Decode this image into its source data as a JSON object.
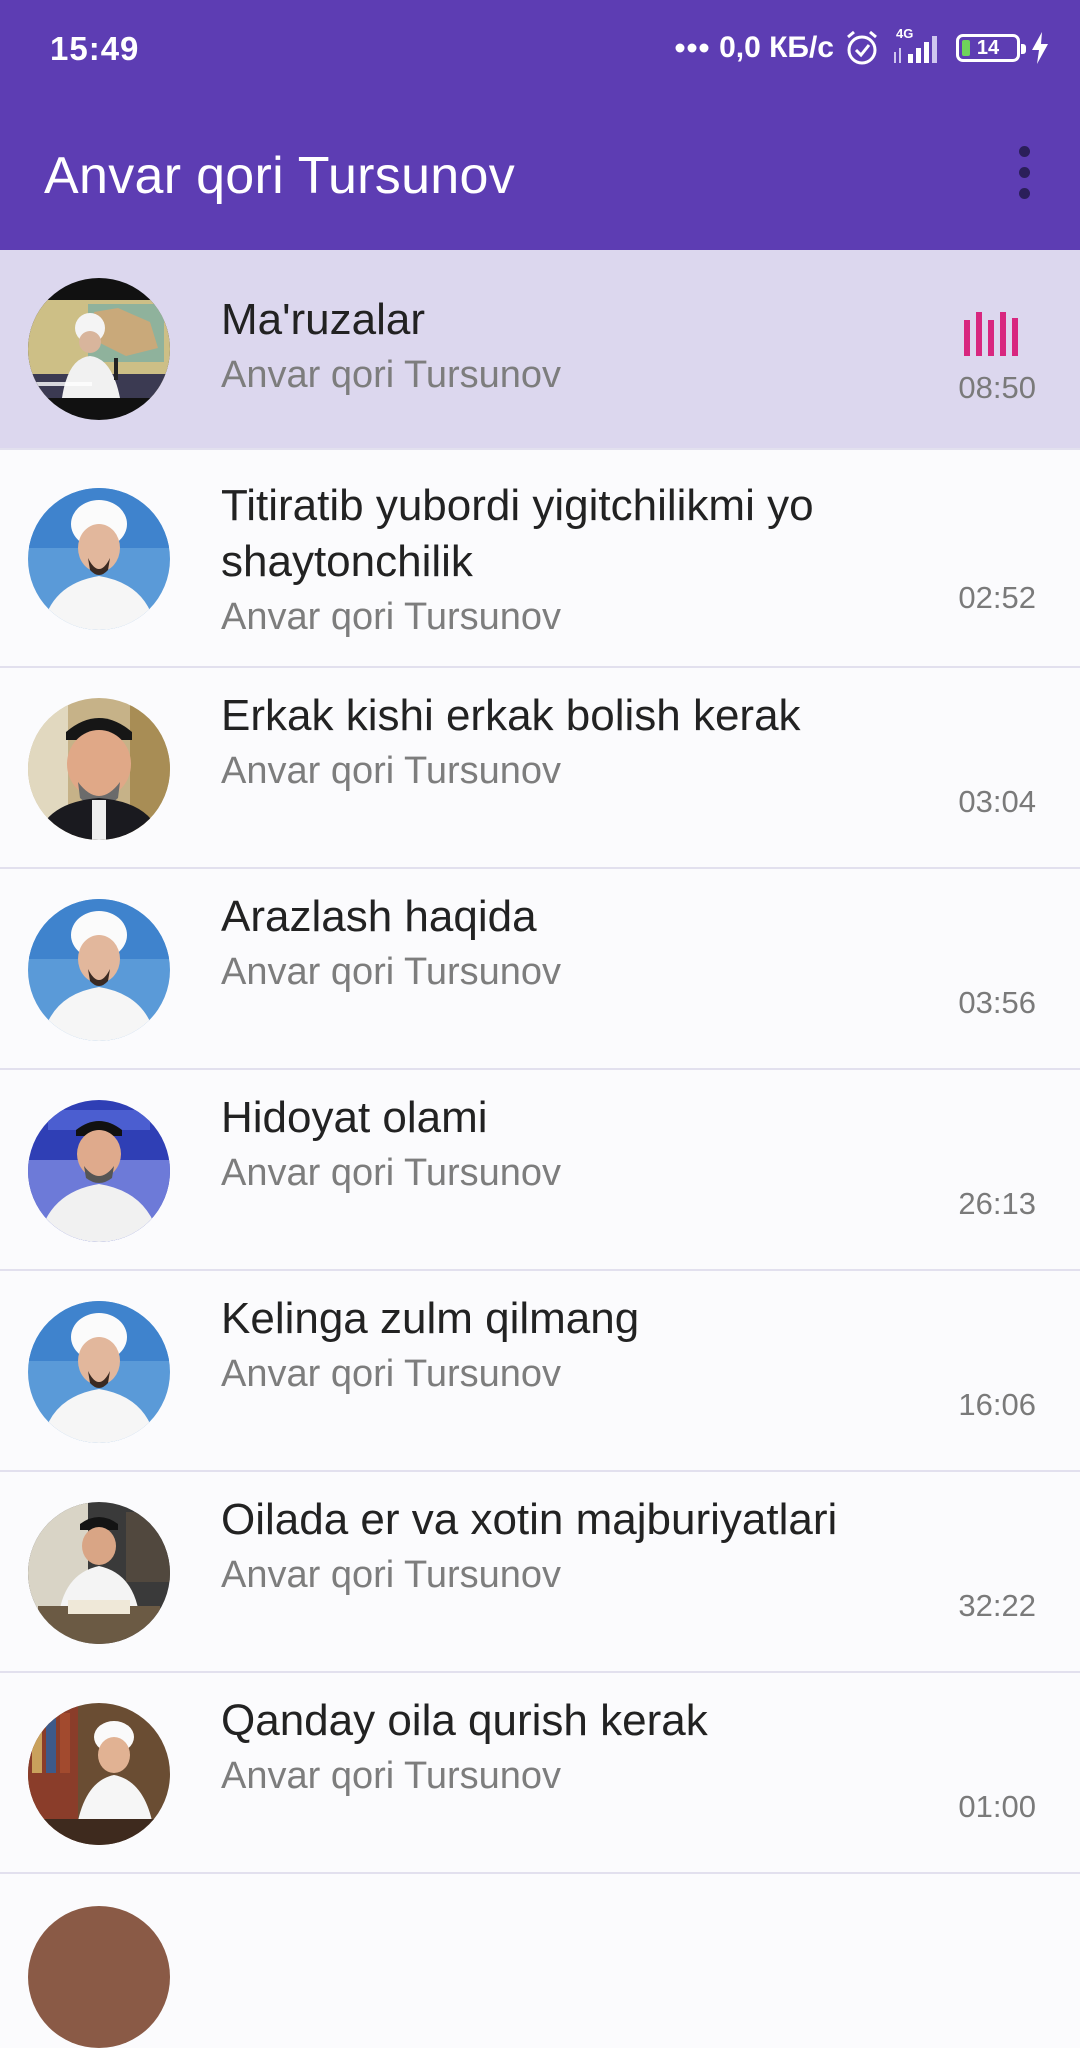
{
  "status_bar": {
    "time": "15:49",
    "network_speed": "0,0 КБ/с",
    "network_type": "4G",
    "battery_level": "14",
    "icons": [
      "dots-icon",
      "alarm-icon",
      "signal-icon",
      "battery-icon",
      "charging-icon"
    ]
  },
  "app_bar": {
    "title": "Anvar qori Tursunov",
    "menu_icon": "more-vert-icon"
  },
  "colors": {
    "primary": "#5d3db3",
    "active_row": "#dcd7ee",
    "equalizer": "#d8277f"
  },
  "tracks": [
    {
      "title": "Ma'ruzalar",
      "artist": "Anvar qori Tursunov",
      "duration": "08:50",
      "playing": true
    },
    {
      "title": "Titiratib yubordi yigitchilikmi yo shaytonchilik",
      "artist": "Anvar qori Tursunov",
      "duration": "02:52",
      "playing": false
    },
    {
      "title": "Erkak kishi erkak bolish kerak",
      "artist": "Anvar qori Tursunov",
      "duration": "03:04",
      "playing": false
    },
    {
      "title": "Arazlash haqida",
      "artist": "Anvar qori Tursunov",
      "duration": "03:56",
      "playing": false
    },
    {
      "title": "Hidoyat olami",
      "artist": "Anvar qori Tursunov",
      "duration": "26:13",
      "playing": false
    },
    {
      "title": "Kelinga zulm qilmang",
      "artist": "Anvar qori Tursunov",
      "duration": "16:06",
      "playing": false
    },
    {
      "title": "Oilada er va xotin majburiyatlari",
      "artist": "Anvar qori Tursunov",
      "duration": "32:22",
      "playing": false
    },
    {
      "title": "Qanday oila qurish kerak",
      "artist": "Anvar qori Tursunov",
      "duration": "01:00",
      "playing": false
    }
  ]
}
